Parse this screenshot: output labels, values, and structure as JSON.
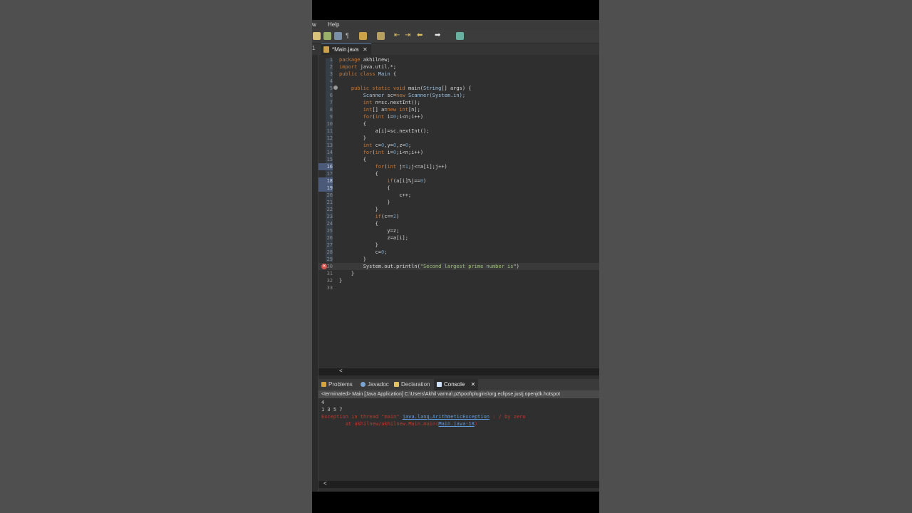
{
  "menu": {
    "partial_item": "w",
    "help": "Help"
  },
  "editor": {
    "tab_title": "*Main.java",
    "tab_close": "✕",
    "left_tab_mark": "1",
    "lines": [
      {
        "num": "1",
        "segments": [
          {
            "t": "package ",
            "c": "kw"
          },
          {
            "t": "akhilnew;",
            "c": ""
          }
        ]
      },
      {
        "num": "2",
        "segments": [
          {
            "t": "import ",
            "c": "kw"
          },
          {
            "t": "java.util.*;",
            "c": ""
          }
        ]
      },
      {
        "num": "3",
        "segments": [
          {
            "t": "public class ",
            "c": "kw"
          },
          {
            "t": "Main",
            "c": "cls"
          },
          {
            "t": " {",
            "c": ""
          }
        ]
      },
      {
        "num": "4",
        "segments": []
      },
      {
        "num": "5",
        "fold": true,
        "segments": [
          {
            "t": "    public static void ",
            "c": "kw"
          },
          {
            "t": "main(",
            "c": ""
          },
          {
            "t": "String",
            "c": "cls"
          },
          {
            "t": "[] args) {",
            "c": ""
          }
        ]
      },
      {
        "num": "6",
        "segments": [
          {
            "t": "        ",
            "c": ""
          },
          {
            "t": "Scanner",
            "c": "cls"
          },
          {
            "t": " sc=",
            "c": ""
          },
          {
            "t": "new ",
            "c": "kw"
          },
          {
            "t": "Scanner(System.in);",
            "c": "cls"
          }
        ]
      },
      {
        "num": "7",
        "segments": [
          {
            "t": "        ",
            "c": ""
          },
          {
            "t": "int ",
            "c": "kw"
          },
          {
            "t": "n=sc.nextInt();",
            "c": ""
          }
        ]
      },
      {
        "num": "8",
        "segments": [
          {
            "t": "        ",
            "c": ""
          },
          {
            "t": "int",
            "c": "kw"
          },
          {
            "t": "[] a=",
            "c": ""
          },
          {
            "t": "new int",
            "c": "kw"
          },
          {
            "t": "[n];",
            "c": ""
          }
        ]
      },
      {
        "num": "9",
        "segments": [
          {
            "t": "        ",
            "c": ""
          },
          {
            "t": "for",
            "c": "kw"
          },
          {
            "t": "(",
            "c": ""
          },
          {
            "t": "int ",
            "c": "kw"
          },
          {
            "t": "i=",
            "c": ""
          },
          {
            "t": "0",
            "c": "num"
          },
          {
            "t": ";i<n;i++)",
            "c": ""
          }
        ]
      },
      {
        "num": "10",
        "segments": [
          {
            "t": "        {",
            "c": ""
          }
        ]
      },
      {
        "num": "11",
        "segments": [
          {
            "t": "            a[i]=sc.nextInt();",
            "c": ""
          }
        ]
      },
      {
        "num": "12",
        "segments": [
          {
            "t": "        }",
            "c": ""
          }
        ]
      },
      {
        "num": "13",
        "segments": [
          {
            "t": "        ",
            "c": ""
          },
          {
            "t": "int ",
            "c": "kw"
          },
          {
            "t": "c=",
            "c": ""
          },
          {
            "t": "0",
            "c": "num"
          },
          {
            "t": ",y=",
            "c": ""
          },
          {
            "t": "0",
            "c": "num"
          },
          {
            "t": ",z=",
            "c": ""
          },
          {
            "t": "0",
            "c": "num"
          },
          {
            "t": ";",
            "c": ""
          }
        ]
      },
      {
        "num": "14",
        "segments": [
          {
            "t": "        ",
            "c": ""
          },
          {
            "t": "for",
            "c": "kw"
          },
          {
            "t": "(",
            "c": ""
          },
          {
            "t": "int ",
            "c": "kw"
          },
          {
            "t": "i=",
            "c": ""
          },
          {
            "t": "0",
            "c": "num"
          },
          {
            "t": ";i<n;i++)",
            "c": ""
          }
        ]
      },
      {
        "num": "15",
        "segments": [
          {
            "t": "        {",
            "c": ""
          }
        ]
      },
      {
        "num": "16",
        "mark": true,
        "segments": [
          {
            "t": "            ",
            "c": ""
          },
          {
            "t": "for",
            "c": "kw"
          },
          {
            "t": "(",
            "c": ""
          },
          {
            "t": "int ",
            "c": "kw"
          },
          {
            "t": "j=",
            "c": ""
          },
          {
            "t": "1",
            "c": "num"
          },
          {
            "t": ";j<=a[i];j++)",
            "c": ""
          }
        ]
      },
      {
        "num": "17",
        "segments": [
          {
            "t": "            {",
            "c": ""
          }
        ]
      },
      {
        "num": "18",
        "mark": true,
        "segments": [
          {
            "t": "                ",
            "c": ""
          },
          {
            "t": "if",
            "c": "kw"
          },
          {
            "t": "(a[i]%j==",
            "c": ""
          },
          {
            "t": "0",
            "c": "num"
          },
          {
            "t": ")",
            "c": ""
          }
        ]
      },
      {
        "num": "19",
        "mark": true,
        "segments": [
          {
            "t": "                {",
            "c": ""
          }
        ]
      },
      {
        "num": "20",
        "segments": [
          {
            "t": "                    c++;",
            "c": ""
          }
        ]
      },
      {
        "num": "21",
        "segments": [
          {
            "t": "                }",
            "c": ""
          }
        ]
      },
      {
        "num": "22",
        "segments": [
          {
            "t": "            }",
            "c": ""
          }
        ]
      },
      {
        "num": "23",
        "segments": [
          {
            "t": "            ",
            "c": ""
          },
          {
            "t": "if",
            "c": "kw"
          },
          {
            "t": "(c==",
            "c": ""
          },
          {
            "t": "2",
            "c": "num"
          },
          {
            "t": ")",
            "c": ""
          }
        ]
      },
      {
        "num": "24",
        "segments": [
          {
            "t": "            {",
            "c": ""
          }
        ]
      },
      {
        "num": "25",
        "segments": [
          {
            "t": "                y=z;",
            "c": ""
          }
        ]
      },
      {
        "num": "26",
        "segments": [
          {
            "t": "                z=a[i];",
            "c": ""
          }
        ]
      },
      {
        "num": "27",
        "segments": [
          {
            "t": "            }",
            "c": ""
          }
        ]
      },
      {
        "num": "28",
        "segments": [
          {
            "t": "            c=",
            "c": ""
          },
          {
            "t": "0",
            "c": "num"
          },
          {
            "t": ";",
            "c": ""
          }
        ]
      },
      {
        "num": "29",
        "segments": [
          {
            "t": "        }",
            "c": ""
          }
        ]
      },
      {
        "num": "30",
        "error": true,
        "current": true,
        "segments": [
          {
            "t": "        System.out.println(",
            "c": ""
          },
          {
            "t": "\"Second largest prime number is",
            "c": "str"
          },
          {
            "t": "\")",
            "c": ""
          }
        ]
      },
      {
        "num": "31",
        "segments": [
          {
            "t": "    }",
            "c": ""
          }
        ]
      },
      {
        "num": "32",
        "segments": [
          {
            "t": "}",
            "c": ""
          }
        ]
      },
      {
        "num": "33",
        "segments": []
      }
    ],
    "scroll_left": "<"
  },
  "panel": {
    "tabs": [
      {
        "label": "Problems",
        "icon_color": "#d9a23a"
      },
      {
        "label": "Javadoc",
        "icon_color": "#7aa6d6"
      },
      {
        "label": "Declaration",
        "icon_color": "#e0c060"
      },
      {
        "label": "Console",
        "icon_color": "#cfe3ff"
      }
    ],
    "console_close": "✕",
    "terminated": "<terminated> Main [Java Application] C:\\Users\\Akhil varma\\.p2\\pool\\plugins\\org.eclipse.justj.openjdk.hotspot",
    "console_lines": {
      "l1": "4",
      "l2": "1 3 5 7",
      "l3_prefix": "Exception in thread \"main\" ",
      "l3_link": "java.lang.ArithmeticException",
      "l3_suffix": " : / by zero",
      "l4_prefix": "\tat akhilnew/akhilnew.Main.main(",
      "l4_link": "Main.java:18",
      "l4_suffix": ")"
    },
    "scroll_left": "<"
  }
}
